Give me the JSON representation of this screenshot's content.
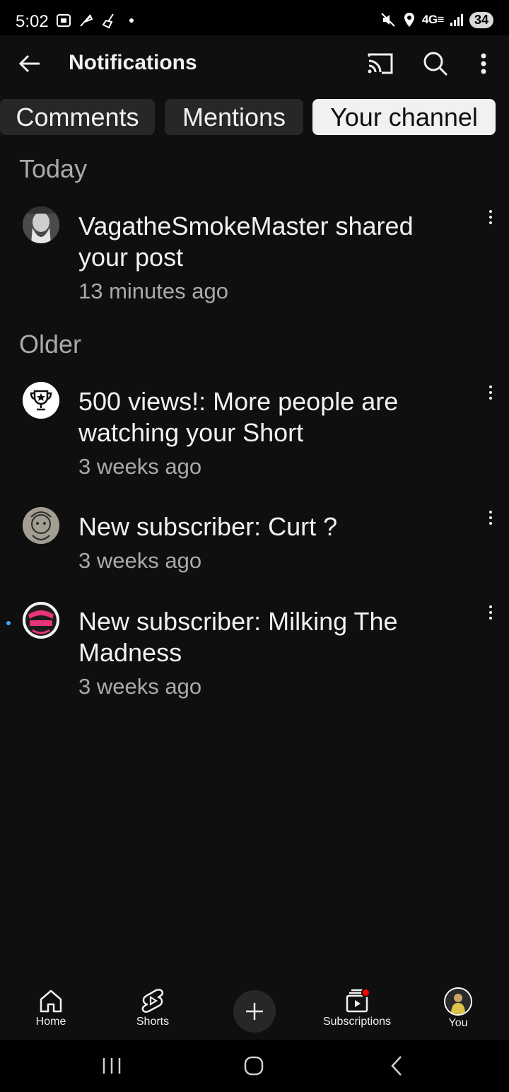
{
  "status_bar": {
    "time": "5:02",
    "network": "4G≡",
    "battery": "34"
  },
  "header": {
    "title": "Notifications"
  },
  "tabs": [
    {
      "label": "Comments",
      "active": false
    },
    {
      "label": "Mentions",
      "active": false
    },
    {
      "label": "Your channel",
      "active": true
    }
  ],
  "sections": {
    "today": "Today",
    "older": "Older"
  },
  "notifications": [
    {
      "text": "VagatheSmokeMaster shared your post",
      "time": "13 minutes ago",
      "avatar": "user-avatar",
      "unread": false
    },
    {
      "text": "500 views!: More people are watching your Short",
      "time": "3 weeks ago",
      "avatar": "trophy-icon",
      "unread": false
    },
    {
      "text": "New subscriber: Curt ?",
      "time": "3 weeks ago",
      "avatar": "user-avatar",
      "unread": false
    },
    {
      "text": "New subscriber: Milking The Madness",
      "time": "3 weeks ago",
      "avatar": "channel-avatar",
      "unread": true
    }
  ],
  "bottom_nav": {
    "home": "Home",
    "shorts": "Shorts",
    "subscriptions": "Subscriptions",
    "you": "You"
  },
  "colors": {
    "background": "#0f0f0f",
    "chip": "#272727",
    "chip_active": "#f1f1f1",
    "secondary_text": "#aaaaaa",
    "unread_dot": "#3ea6ff",
    "badge_red": "#ff0000"
  }
}
